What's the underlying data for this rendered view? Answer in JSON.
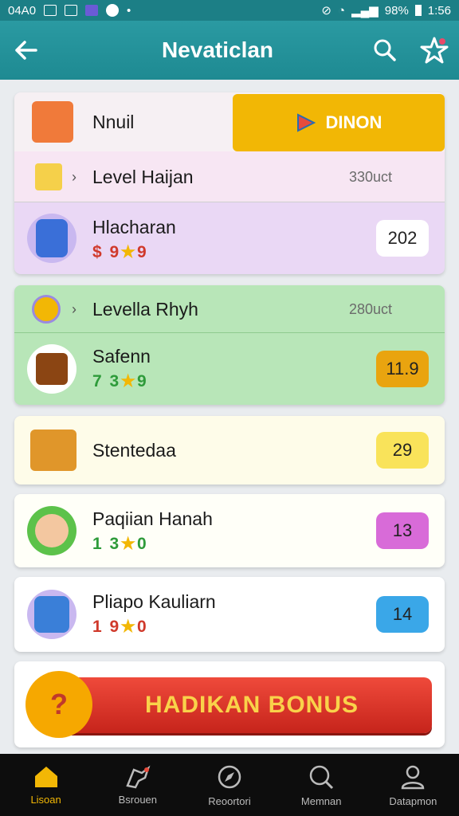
{
  "status_bar": {
    "left_text": "04A0",
    "right_battery": "98%",
    "right_time": "1:56"
  },
  "header": {
    "title": "Nevaticlan"
  },
  "top_card": {
    "header_label": "Nnuil",
    "header_button": "DINON",
    "rows": [
      {
        "name": "Level Haijan",
        "meta": "330uct"
      },
      {
        "name": "Hlacharan",
        "sub": "9",
        "sub_prefix": "$",
        "sub_suffix": "9",
        "badge": "202"
      }
    ]
  },
  "green_card": {
    "rows": [
      {
        "name": "Levella Rhyh",
        "meta": "280uct"
      },
      {
        "name": "Safenn",
        "sub_prefix": "7",
        "sub": "3",
        "sub_suffix": "9",
        "badge": "11.9"
      }
    ]
  },
  "items": [
    {
      "name": "Stentedaa",
      "badge": "29",
      "badge_color": "#f9e35a"
    },
    {
      "name": "Paqiian Hanah",
      "sub_prefix": "1",
      "sub": "3",
      "sub_suffix": "0",
      "badge": "13",
      "badge_color": "#d86bd8"
    },
    {
      "name": "Pliapo Kauliarn",
      "sub_prefix": "1",
      "sub": "9",
      "sub_suffix": "0",
      "badge": "14",
      "badge_color": "#3aa7e8"
    }
  ],
  "bonus": {
    "label": "HADIKAN BONUS"
  },
  "bottom_nav": [
    {
      "label": "Lisoan",
      "icon": "home-icon"
    },
    {
      "label": "Bsrouen",
      "icon": "hawk-icon"
    },
    {
      "label": "Reoortori",
      "icon": "compass-icon"
    },
    {
      "label": "Memnan",
      "icon": "search-icon"
    },
    {
      "label": "Datapmon",
      "icon": "user-icon"
    }
  ],
  "colors": {
    "accent": "#1e8a92",
    "yellow": "#f2b705",
    "green": "#b8e6b8",
    "purple": "#ead8f5"
  }
}
